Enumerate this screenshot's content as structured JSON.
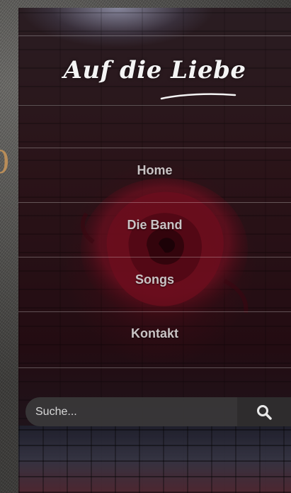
{
  "brand": {
    "logo_text": "Auf die Liebe"
  },
  "nav": {
    "items": [
      {
        "label": "Home"
      },
      {
        "label": "Die Band"
      },
      {
        "label": "Songs"
      },
      {
        "label": "Kontakt"
      }
    ]
  },
  "search": {
    "placeholder": "Suche...",
    "value": "",
    "icon": "search-icon"
  },
  "colors": {
    "nav_text": "#c9c3c4",
    "panel_bg": "#2a1318",
    "rose": "#7a0e1e",
    "search_bg": "#3a383a"
  }
}
